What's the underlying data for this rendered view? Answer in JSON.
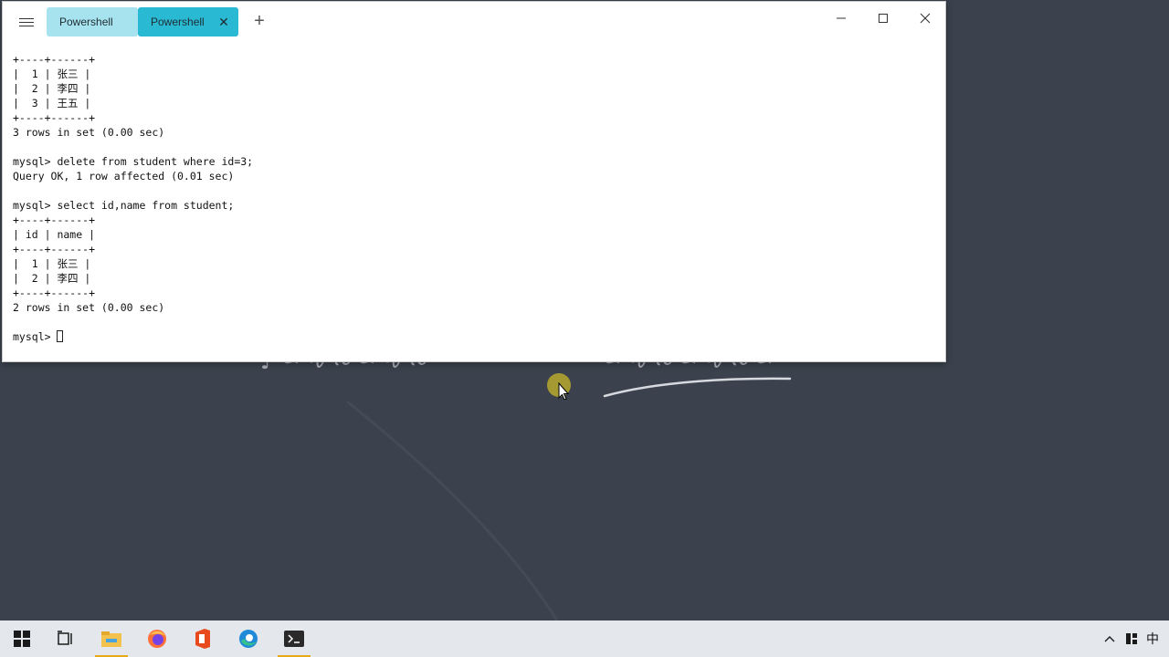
{
  "window": {
    "tabs": [
      {
        "label": "Powershell",
        "active": false
      },
      {
        "label": "Powershell",
        "active": true
      }
    ],
    "new_tab_symbol": "+",
    "close_tab_symbol": "✕"
  },
  "console": {
    "lines": [
      "+----+------+",
      "|  1 | 张三 |",
      "|  2 | 李四 |",
      "|  3 | 王五 |",
      "+----+------+",
      "3 rows in set (0.00 sec)",
      "",
      "mysql> delete from student where id=3;",
      "Query OK, 1 row affected (0.01 sec)",
      "",
      "mysql> select id,name from student;",
      "+----+------+",
      "| id | name |",
      "+----+------+",
      "|  1 | 张三 |",
      "|  2 | 李四 |",
      "+----+------+",
      "2 rows in set (0.00 sec)",
      ""
    ],
    "prompt": "mysql> "
  },
  "taskbar": {
    "items": [
      {
        "name": "start-icon"
      },
      {
        "name": "task-view-icon"
      },
      {
        "name": "file-explorer-icon",
        "active": true
      },
      {
        "name": "firefox-icon"
      },
      {
        "name": "office-icon"
      },
      {
        "name": "edge-icon"
      },
      {
        "name": "terminal-icon",
        "active": true
      }
    ],
    "ime_label": "中"
  },
  "colors": {
    "desktop": "#3b424d",
    "tab_inactive": "#a6e3ee",
    "tab_active": "#29b9d2",
    "taskbar": "#e4e7ec",
    "active_indicator": "#e8a916"
  }
}
